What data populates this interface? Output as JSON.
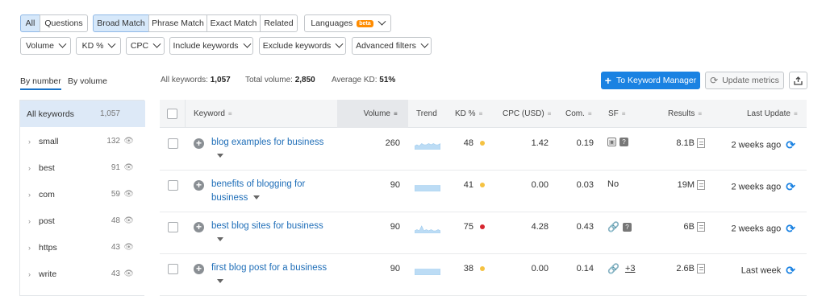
{
  "match_tabs": {
    "all": "All",
    "questions": "Questions",
    "broad": "Broad Match",
    "phrase": "Phrase Match",
    "exact": "Exact Match",
    "related": "Related",
    "languages": "Languages",
    "beta": "beta"
  },
  "filters": [
    "Volume",
    "KD %",
    "CPC",
    "Include keywords",
    "Exclude keywords",
    "Advanced filters"
  ],
  "group_tabs": {
    "by_number": "By number",
    "by_volume": "By volume"
  },
  "stats": {
    "all_keywords_label": "All keywords:",
    "all_keywords_value": "1,057",
    "total_volume_label": "Total volume:",
    "total_volume_value": "2,850",
    "avg_kd_label": "Average KD:",
    "avg_kd_value": "51%"
  },
  "actions": {
    "to_keyword_manager": "To Keyword Manager",
    "update_metrics": "Update metrics"
  },
  "sidebar": {
    "all_label": "All keywords",
    "all_count": "1,057",
    "items": [
      {
        "label": "small",
        "count": "132"
      },
      {
        "label": "best",
        "count": "91"
      },
      {
        "label": "com",
        "count": "59"
      },
      {
        "label": "post",
        "count": "48"
      },
      {
        "label": "https",
        "count": "43"
      },
      {
        "label": "write",
        "count": "43"
      }
    ]
  },
  "table": {
    "headers": {
      "keyword": "Keyword",
      "volume": "Volume",
      "trend": "Trend",
      "kd": "KD %",
      "cpc": "CPC (USD)",
      "com": "Com.",
      "sf": "SF",
      "results": "Results",
      "last_update": "Last Update"
    },
    "rows": [
      {
        "keyword": "blog examples for business",
        "volume": "260",
        "kd": "48",
        "kd_color": "#f5c242",
        "cpc": "1.42",
        "com": "0.19",
        "sf": "",
        "results": "8.1B",
        "last_update": "2 weeks ago",
        "trend": [
          3,
          4,
          3,
          5,
          4,
          4,
          5,
          4,
          5,
          4,
          4,
          5
        ]
      },
      {
        "keyword": "benefits of blogging for business",
        "volume": "90",
        "kd": "41",
        "kd_color": "#f5c242",
        "cpc": "0.00",
        "com": "0.03",
        "sf": "No",
        "results": "19M",
        "last_update": "2 weeks ago",
        "trend": [
          5,
          5,
          5,
          5,
          5,
          5,
          5,
          5,
          5,
          5,
          5,
          5
        ]
      },
      {
        "keyword": "best blog sites for business",
        "volume": "90",
        "kd": "75",
        "kd_color": "#d6262f",
        "cpc": "4.28",
        "com": "0.43",
        "sf": "",
        "results": "6B",
        "last_update": "2 weeks ago",
        "trend": [
          2,
          3,
          2,
          6,
          2,
          3,
          2,
          3,
          2,
          2,
          3,
          2
        ]
      },
      {
        "keyword": "first blog post for a business",
        "volume": "90",
        "kd": "38",
        "kd_color": "#f5c242",
        "cpc": "0.00",
        "com": "0.14",
        "sf": "+3",
        "results": "2.6B",
        "last_update": "Last week",
        "trend": [
          5,
          5,
          5,
          5,
          5,
          5,
          5,
          5,
          5,
          5,
          5,
          5
        ]
      }
    ]
  }
}
